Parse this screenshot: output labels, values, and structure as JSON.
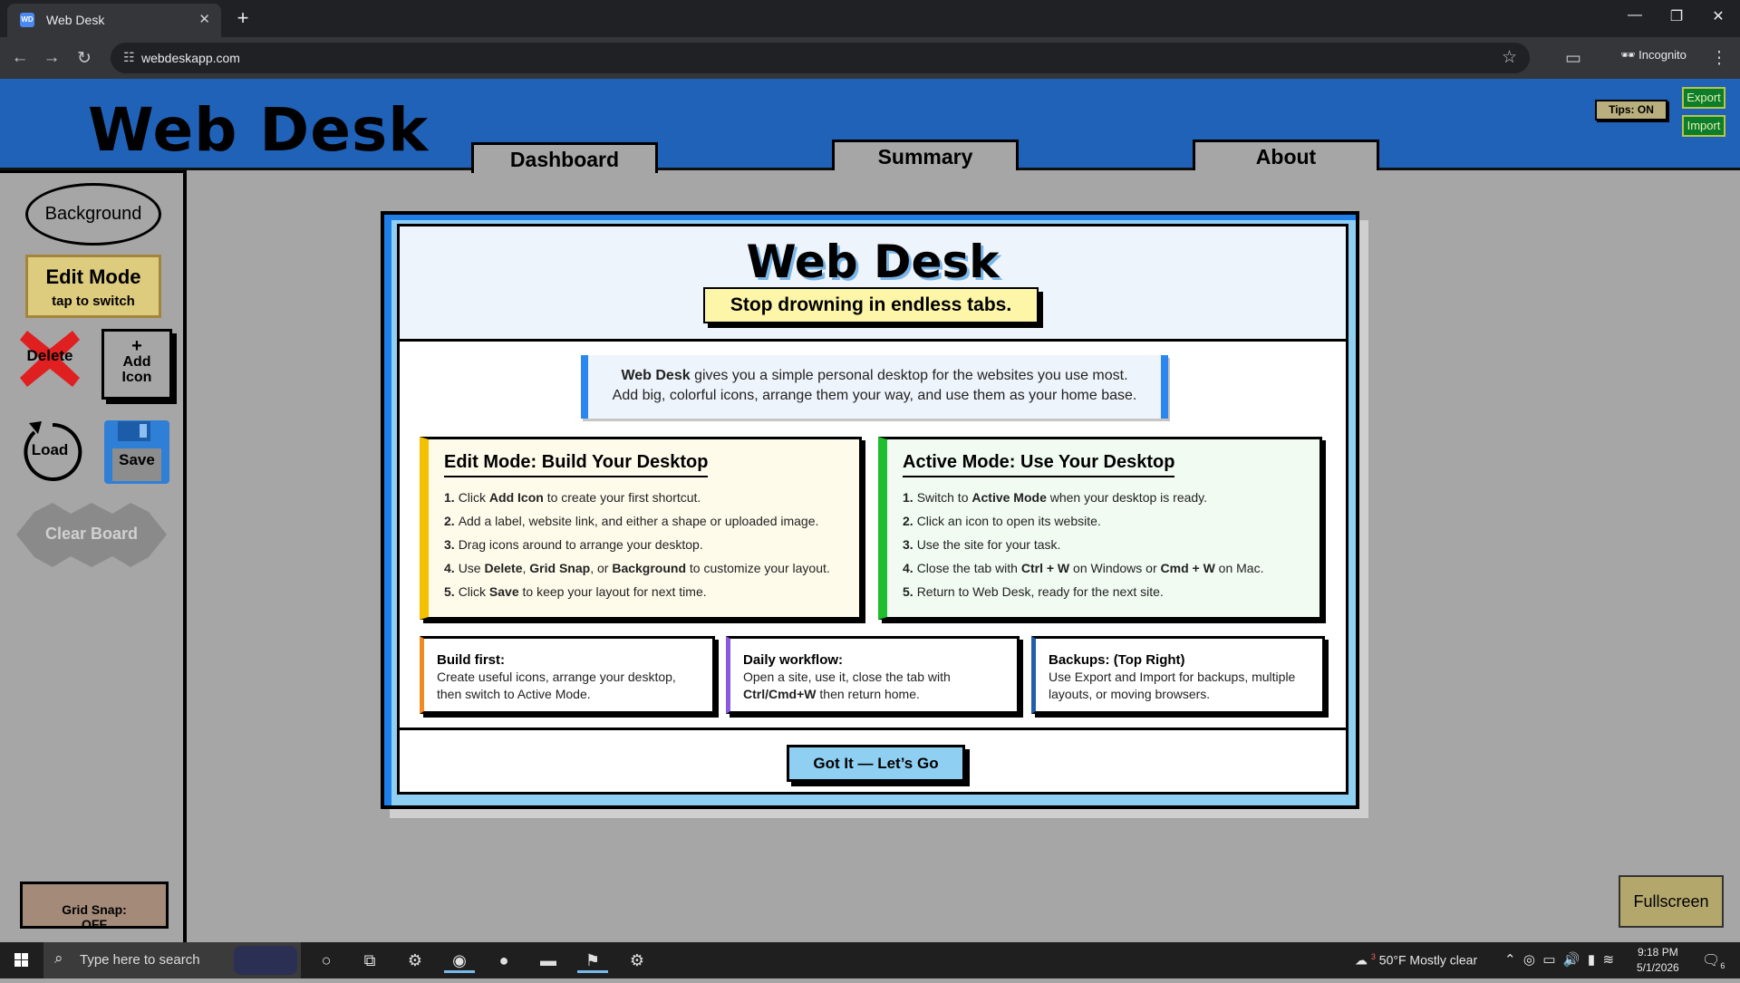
{
  "browser": {
    "tab_title": "Web Desk",
    "tab_icon": "WD",
    "url": "webdeskapp.com",
    "incognito_label": "Incognito"
  },
  "app": {
    "title": "Web Desk",
    "nav": {
      "dashboard": "Dashboard",
      "summary": "Summary",
      "about": "About"
    },
    "tips_label": "Tips: ON",
    "export_label": "Export",
    "import_label": "Import",
    "fullscreen_label": "Fullscreen",
    "colors": {
      "header": "#1f62b8",
      "canvas": "#a6a6a6",
      "accent_blue": "#2b86ef"
    }
  },
  "sidebar": {
    "background": "Background",
    "edit_mode": {
      "title": "Edit Mode",
      "subtitle": "tap to switch"
    },
    "delete": "Delete",
    "add_icon": {
      "plus": "+",
      "line1": "Add",
      "line2": "Icon"
    },
    "load": "Load",
    "save": "Save",
    "clear_board": "Clear Board",
    "grid_snap": {
      "label": "Grid Snap:",
      "state": "OFF"
    }
  },
  "modal": {
    "title": "Web Desk",
    "tagline": "Stop drowning in endless tabs.",
    "intro": {
      "brand": "Web Desk",
      "line1": " gives you a simple personal desktop for the websites you use most.",
      "line2": "Add big, colorful icons, arrange them your way, and use them as your home base."
    },
    "edit_card": {
      "heading": "Edit Mode: Build Your Desktop",
      "steps": [
        {
          "n": "1.",
          "parts": [
            [
              "",
              "Click "
            ],
            [
              "b",
              "Add Icon"
            ],
            [
              "",
              " to create your first shortcut."
            ]
          ]
        },
        {
          "n": "2.",
          "parts": [
            [
              "",
              "Add a label, website link, and either a shape or uploaded image."
            ]
          ]
        },
        {
          "n": "3.",
          "parts": [
            [
              "",
              "Drag icons around to arrange your desktop."
            ]
          ]
        },
        {
          "n": "4.",
          "parts": [
            [
              "",
              "Use "
            ],
            [
              "b",
              "Delete"
            ],
            [
              "",
              ", "
            ],
            [
              "b",
              "Grid Snap"
            ],
            [
              "",
              ", or "
            ],
            [
              "b",
              "Background"
            ],
            [
              "",
              " to customize your layout."
            ]
          ]
        },
        {
          "n": "5.",
          "parts": [
            [
              "",
              "Click "
            ],
            [
              "b",
              "Save"
            ],
            [
              "",
              " to keep your layout for next time."
            ]
          ]
        }
      ]
    },
    "active_card": {
      "heading": "Active Mode: Use Your Desktop",
      "steps": [
        {
          "n": "1.",
          "parts": [
            [
              "",
              "Switch to "
            ],
            [
              "b",
              "Active Mode"
            ],
            [
              "",
              " when your desktop is ready."
            ]
          ]
        },
        {
          "n": "2.",
          "parts": [
            [
              "",
              "Click an icon to open its website."
            ]
          ]
        },
        {
          "n": "3.",
          "parts": [
            [
              "",
              "Use the site for your task."
            ]
          ]
        },
        {
          "n": "4.",
          "parts": [
            [
              "",
              "Close the tab with "
            ],
            [
              "b",
              "Ctrl + W"
            ],
            [
              "",
              " on Windows or "
            ],
            [
              "b",
              "Cmd + W"
            ],
            [
              "",
              " on Mac."
            ]
          ]
        },
        {
          "n": "5.",
          "parts": [
            [
              "",
              "Return to Web Desk, ready for the next site."
            ]
          ]
        }
      ]
    },
    "tips": [
      {
        "heading": "Build first:",
        "body": "Create useful icons, arrange your desktop, then switch to Active Mode."
      },
      {
        "heading": "Daily workflow:",
        "body_pre": "Open a site, use it, close the tab with ",
        "body_bold": "Ctrl/Cmd+W",
        "body_post": " then return home."
      },
      {
        "heading": "Backups: (Top Right)",
        "body": "Use Export and Import for backups, multiple layouts, or moving browsers."
      }
    ],
    "cta": "Got It — Let’s Go"
  },
  "taskbar": {
    "search_placeholder": "Type here to search",
    "weather": {
      "temp": "50°F",
      "desc": "Mostly clear",
      "badge": "3"
    },
    "time": "9:18 PM",
    "date": "5/1/2026",
    "notifications": "6"
  }
}
